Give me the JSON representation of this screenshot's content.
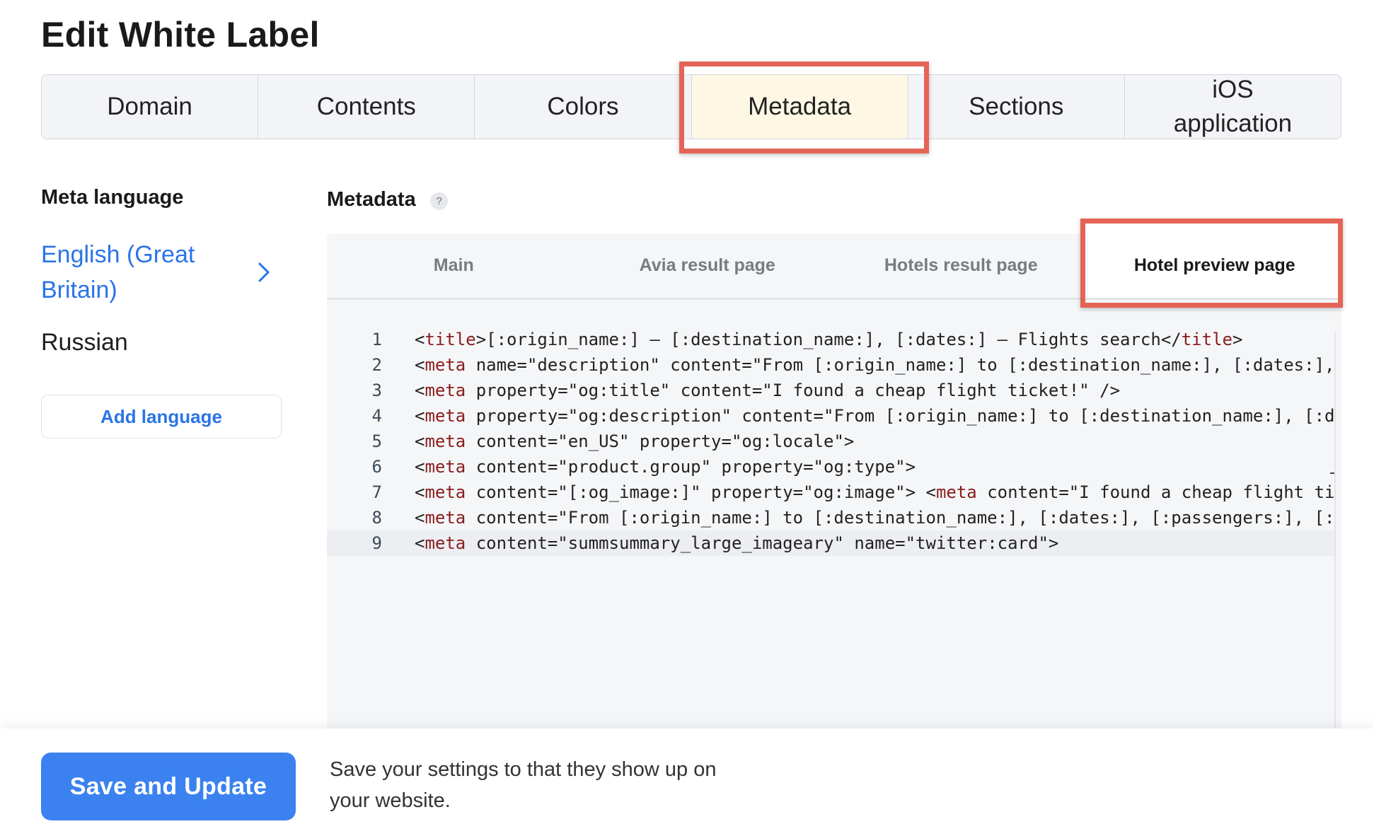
{
  "page": {
    "title": "Edit White Label"
  },
  "top_tabs": [
    {
      "label": "Domain"
    },
    {
      "label": "Contents"
    },
    {
      "label": "Colors"
    },
    {
      "label": "Metadata"
    },
    {
      "label": "Sections"
    },
    {
      "label": "iOS application"
    }
  ],
  "top_tabs_active": "Metadata",
  "meta_language": {
    "title": "Meta language",
    "items": [
      {
        "label": "English (Great Britain)",
        "selected": true
      },
      {
        "label": "Russian",
        "selected": false
      }
    ],
    "add_button": "Add language"
  },
  "metadata": {
    "title": "Metadata",
    "help_icon": "?",
    "sub_tabs": [
      {
        "label": "Main"
      },
      {
        "label": "Avia result page"
      },
      {
        "label": "Hotels result page"
      },
      {
        "label": "Hotel preview page"
      }
    ],
    "sub_tabs_active": "Hotel preview page",
    "code_lines": [
      "<title>[:origin_name:] – [:destination_name:], [:dates:] – Flights search</title>",
      "<meta name=\"description\" content=\"From [:origin_name:] to [:destination_name:], [:dates:],",
      "<meta property=\"og:title\" content=\"I found a cheap flight ticket!\" />",
      "<meta property=\"og:description\" content=\"From [:origin_name:] to [:destination_name:], [:da",
      "<meta content=\"en_US\" property=\"og:locale\">",
      "<meta content=\"product.group\" property=\"og:type\">",
      "<meta content=\"[:og_image:]\" property=\"og:image\"> <meta content=\"I found a cheap flight tic",
      "<meta content=\"From [:origin_name:] to [:destination_name:], [:dates:], [:passengers:], [:",
      "<meta content=\"summsummary_large_imageary\" name=\"twitter:card\">"
    ],
    "current_line": 9
  },
  "footer": {
    "save_button": "Save and Update",
    "hint": "Save your settings to that they show up on your website."
  },
  "colors": {
    "accent": "#3b82f0",
    "link": "#2b74e8",
    "highlight_box": "#e46456",
    "active_tab_bg": "#fdf7e4"
  }
}
